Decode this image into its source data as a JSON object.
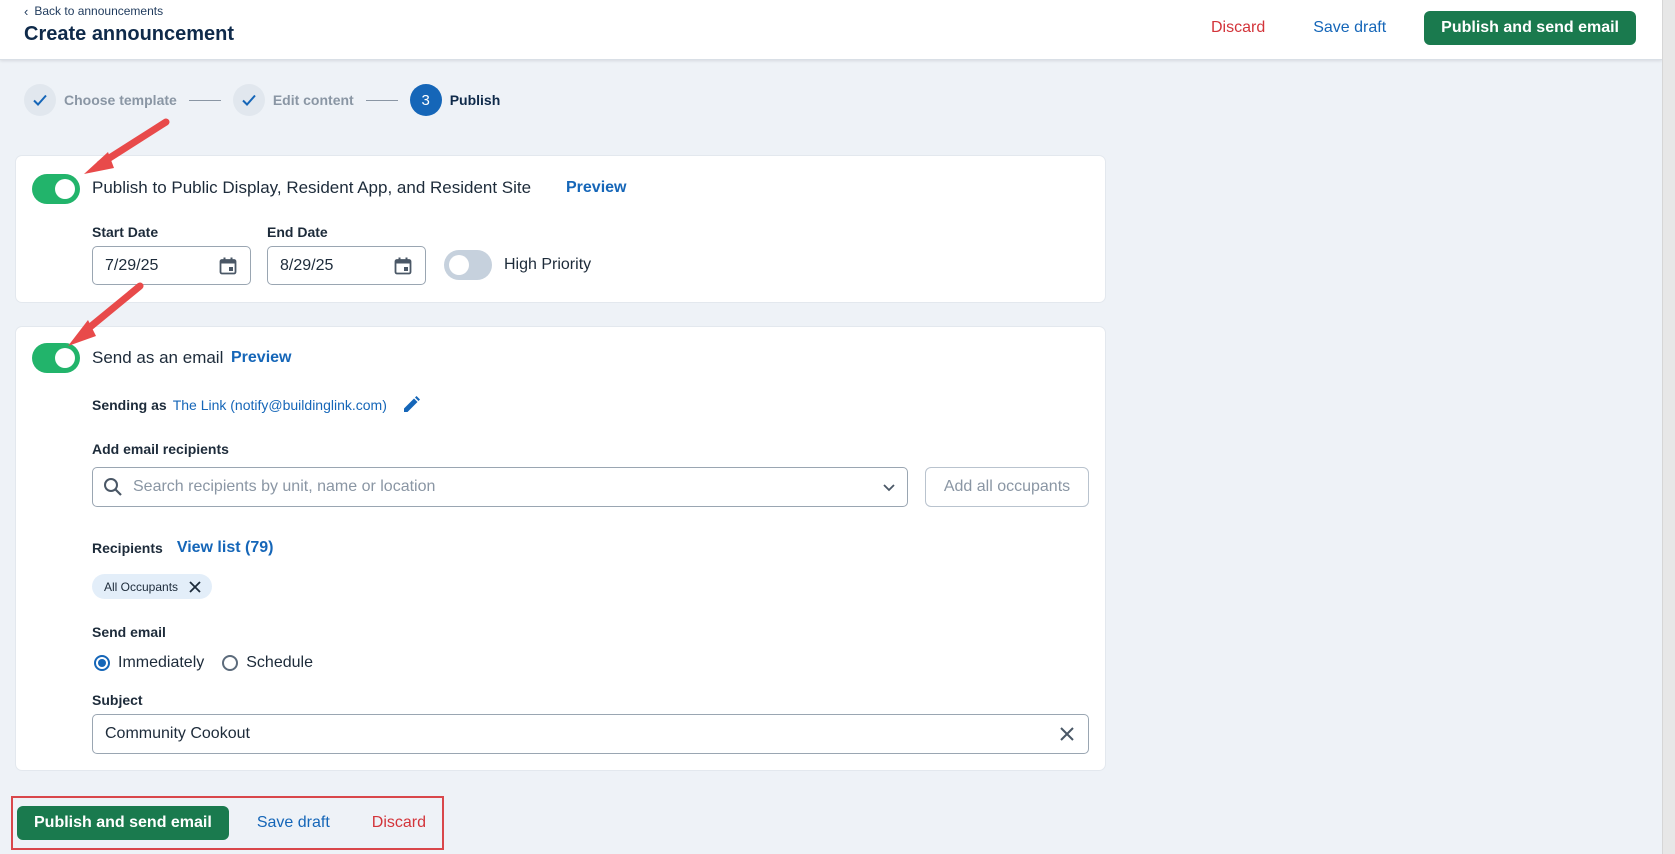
{
  "header": {
    "back_label": "Back to announcements",
    "title": "Create announcement",
    "discard_label": "Discard",
    "save_draft_label": "Save draft",
    "publish_label": "Publish and send email"
  },
  "stepper": {
    "steps": [
      {
        "label": "Choose template",
        "state": "done"
      },
      {
        "label": "Edit content",
        "state": "done"
      },
      {
        "label": "Publish",
        "number": "3",
        "state": "active"
      }
    ]
  },
  "publish_section": {
    "enabled": true,
    "title": "Publish to Public Display, Resident App, and Resident Site",
    "preview_label": "Preview",
    "start_date_label": "Start Date",
    "start_date_value": "7/29/25",
    "end_date_label": "End Date",
    "end_date_value": "8/29/25",
    "high_priority_label": "High Priority",
    "high_priority_enabled": false
  },
  "email_section": {
    "enabled": true,
    "title": "Send as an email",
    "preview_label": "Preview",
    "sending_as_label": "Sending as",
    "sending_as_value": "The Link (notify@buildinglink.com)",
    "add_recipients_label": "Add email recipients",
    "search_placeholder": "Search recipients by unit, name or location",
    "add_all_label": "Add all occupants",
    "recipients_label": "Recipients",
    "view_list_label": "View list (79)",
    "chips": [
      "All Occupants"
    ],
    "send_email_label": "Send email",
    "send_options": [
      {
        "label": "Immediately",
        "checked": true
      },
      {
        "label": "Schedule",
        "checked": false
      }
    ],
    "subject_label": "Subject",
    "subject_value": "Community Cookout"
  },
  "footer": {
    "publish_label": "Publish and send email",
    "save_draft_label": "Save draft",
    "discard_label": "Discard"
  },
  "colors": {
    "primary_green": "#1a7a4e",
    "toggle_green": "#22b46b",
    "link_blue": "#1566b8",
    "discard_red": "#d3343a",
    "annotation_red": "#e84a4a"
  }
}
